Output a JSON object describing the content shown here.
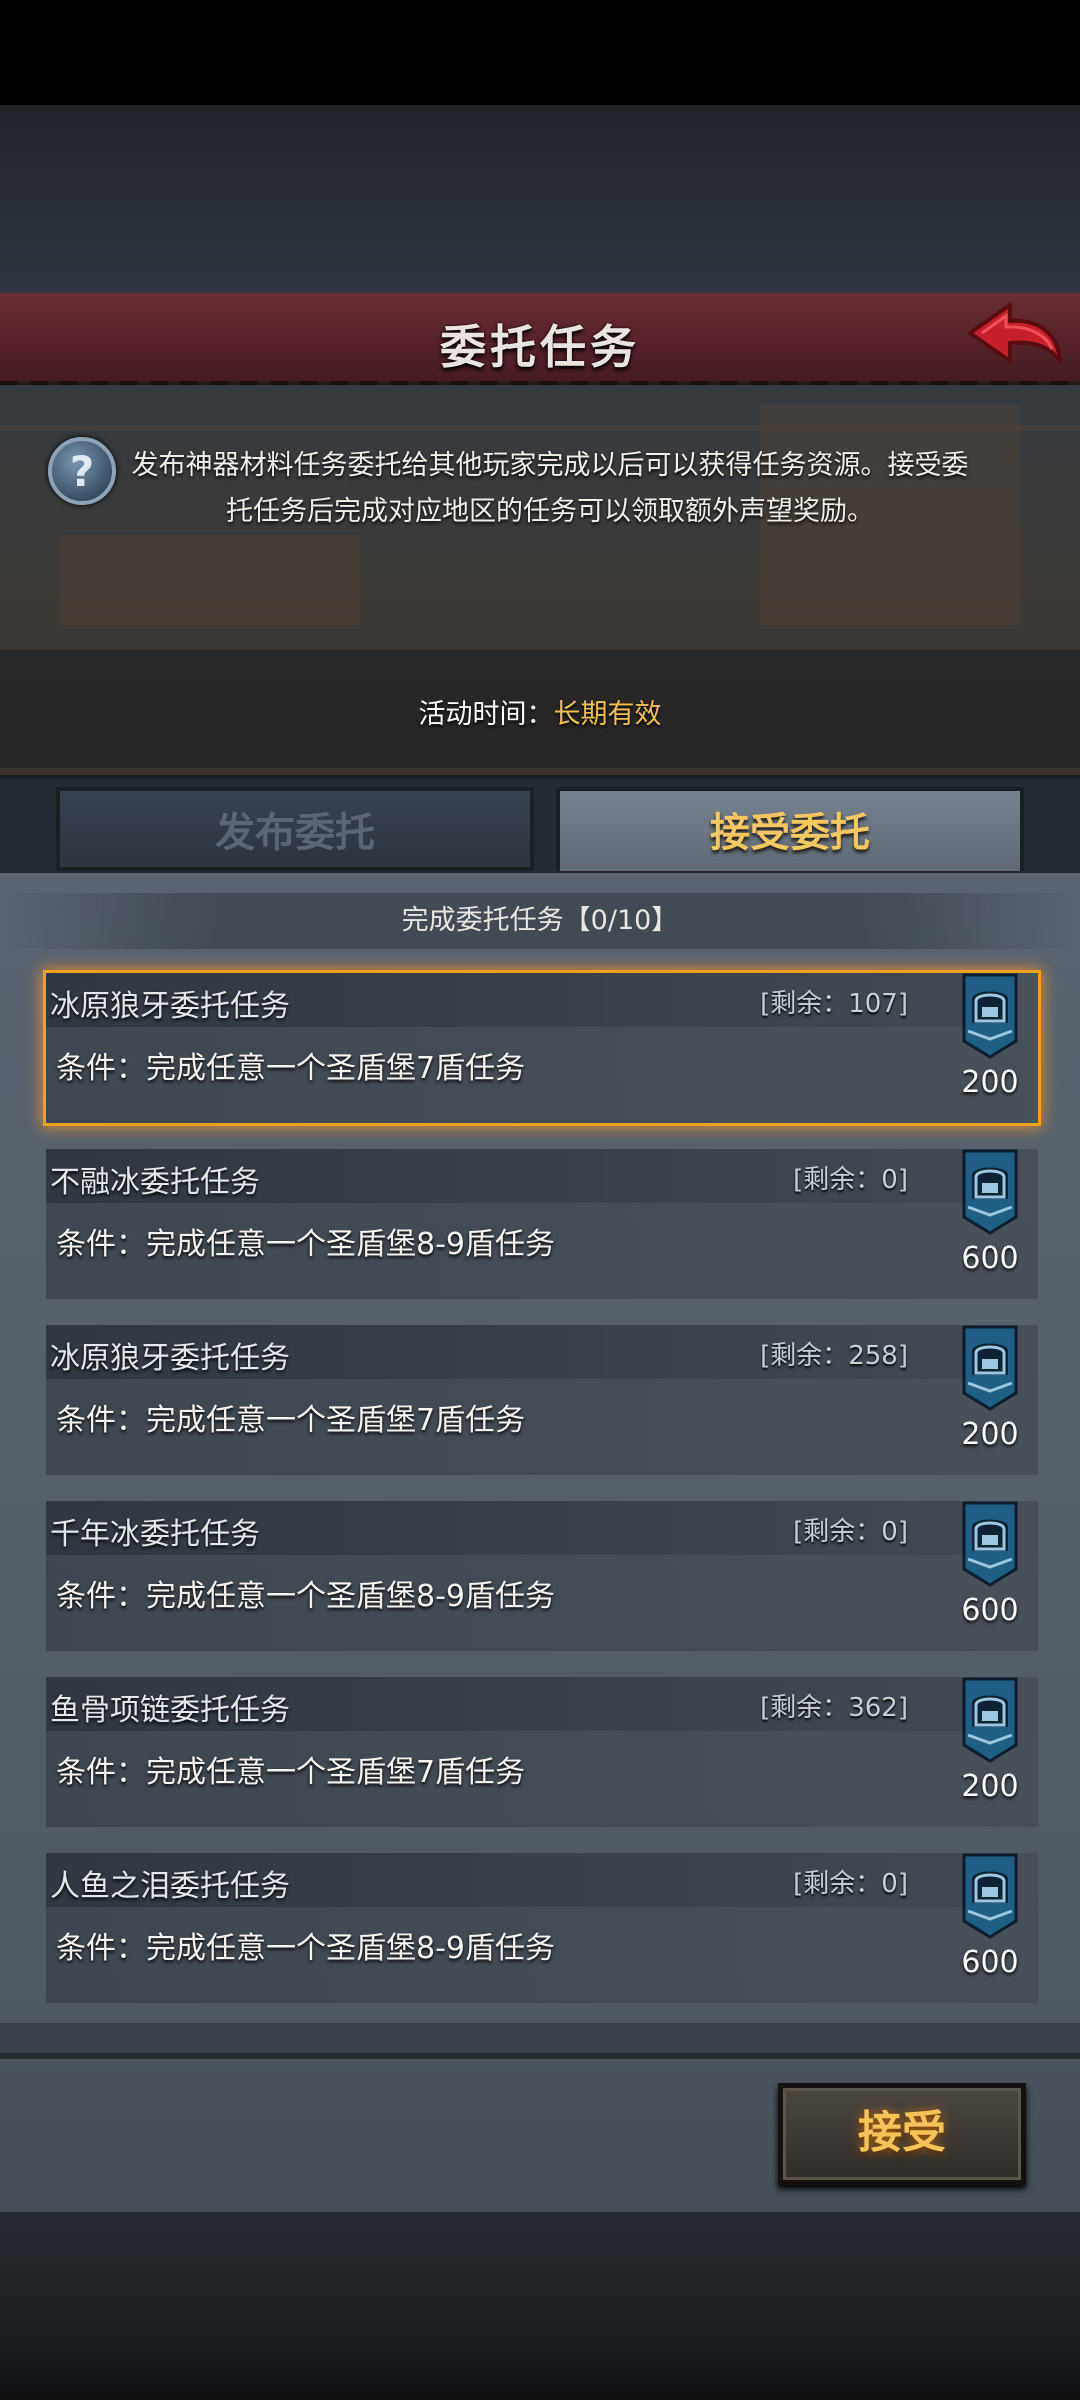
{
  "header": {
    "title": "委托任务",
    "back_icon": "back-arrow-icon"
  },
  "info": {
    "help_icon_glyph": "?",
    "description": "发布神器材料任务委托给其他玩家完成以后可以获得任务资源。接受委托任务后完成对应地区的任务可以领取额外声望奖励。",
    "time_label": "活动时间：",
    "time_value": "长期有效"
  },
  "tabs": [
    {
      "label": "发布委托",
      "active": false
    },
    {
      "label": "接受委托",
      "active": true
    }
  ],
  "summary": "完成委托任务【0/10】",
  "tasks": [
    {
      "name": "冰原狼牙委托任务",
      "remain": "[剩余：107]",
      "condition": "条件：完成任意一个圣盾堡7盾任务",
      "reward": "200",
      "selected": true
    },
    {
      "name": "不融冰委托任务",
      "remain": "[剩余：0]",
      "condition": "条件：完成任意一个圣盾堡8-9盾任务",
      "reward": "600",
      "selected": false
    },
    {
      "name": "冰原狼牙委托任务",
      "remain": "[剩余：258]",
      "condition": "条件：完成任意一个圣盾堡7盾任务",
      "reward": "200",
      "selected": false
    },
    {
      "name": "千年冰委托任务",
      "remain": "[剩余：0]",
      "condition": "条件：完成任意一个圣盾堡8-9盾任务",
      "reward": "600",
      "selected": false
    },
    {
      "name": "鱼骨项链委托任务",
      "remain": "[剩余：362]",
      "condition": "条件：完成任意一个圣盾堡7盾任务",
      "reward": "200",
      "selected": false
    },
    {
      "name": "人鱼之泪委托任务",
      "remain": "[剩余：0]",
      "condition": "条件：完成任意一个圣盾堡8-9盾任务",
      "reward": "600",
      "selected": false
    }
  ],
  "footer": {
    "accept_label": "接受"
  },
  "colors": {
    "accent": "#f2c04f",
    "header": "#56222a",
    "selected_glow": "#f0a020"
  }
}
